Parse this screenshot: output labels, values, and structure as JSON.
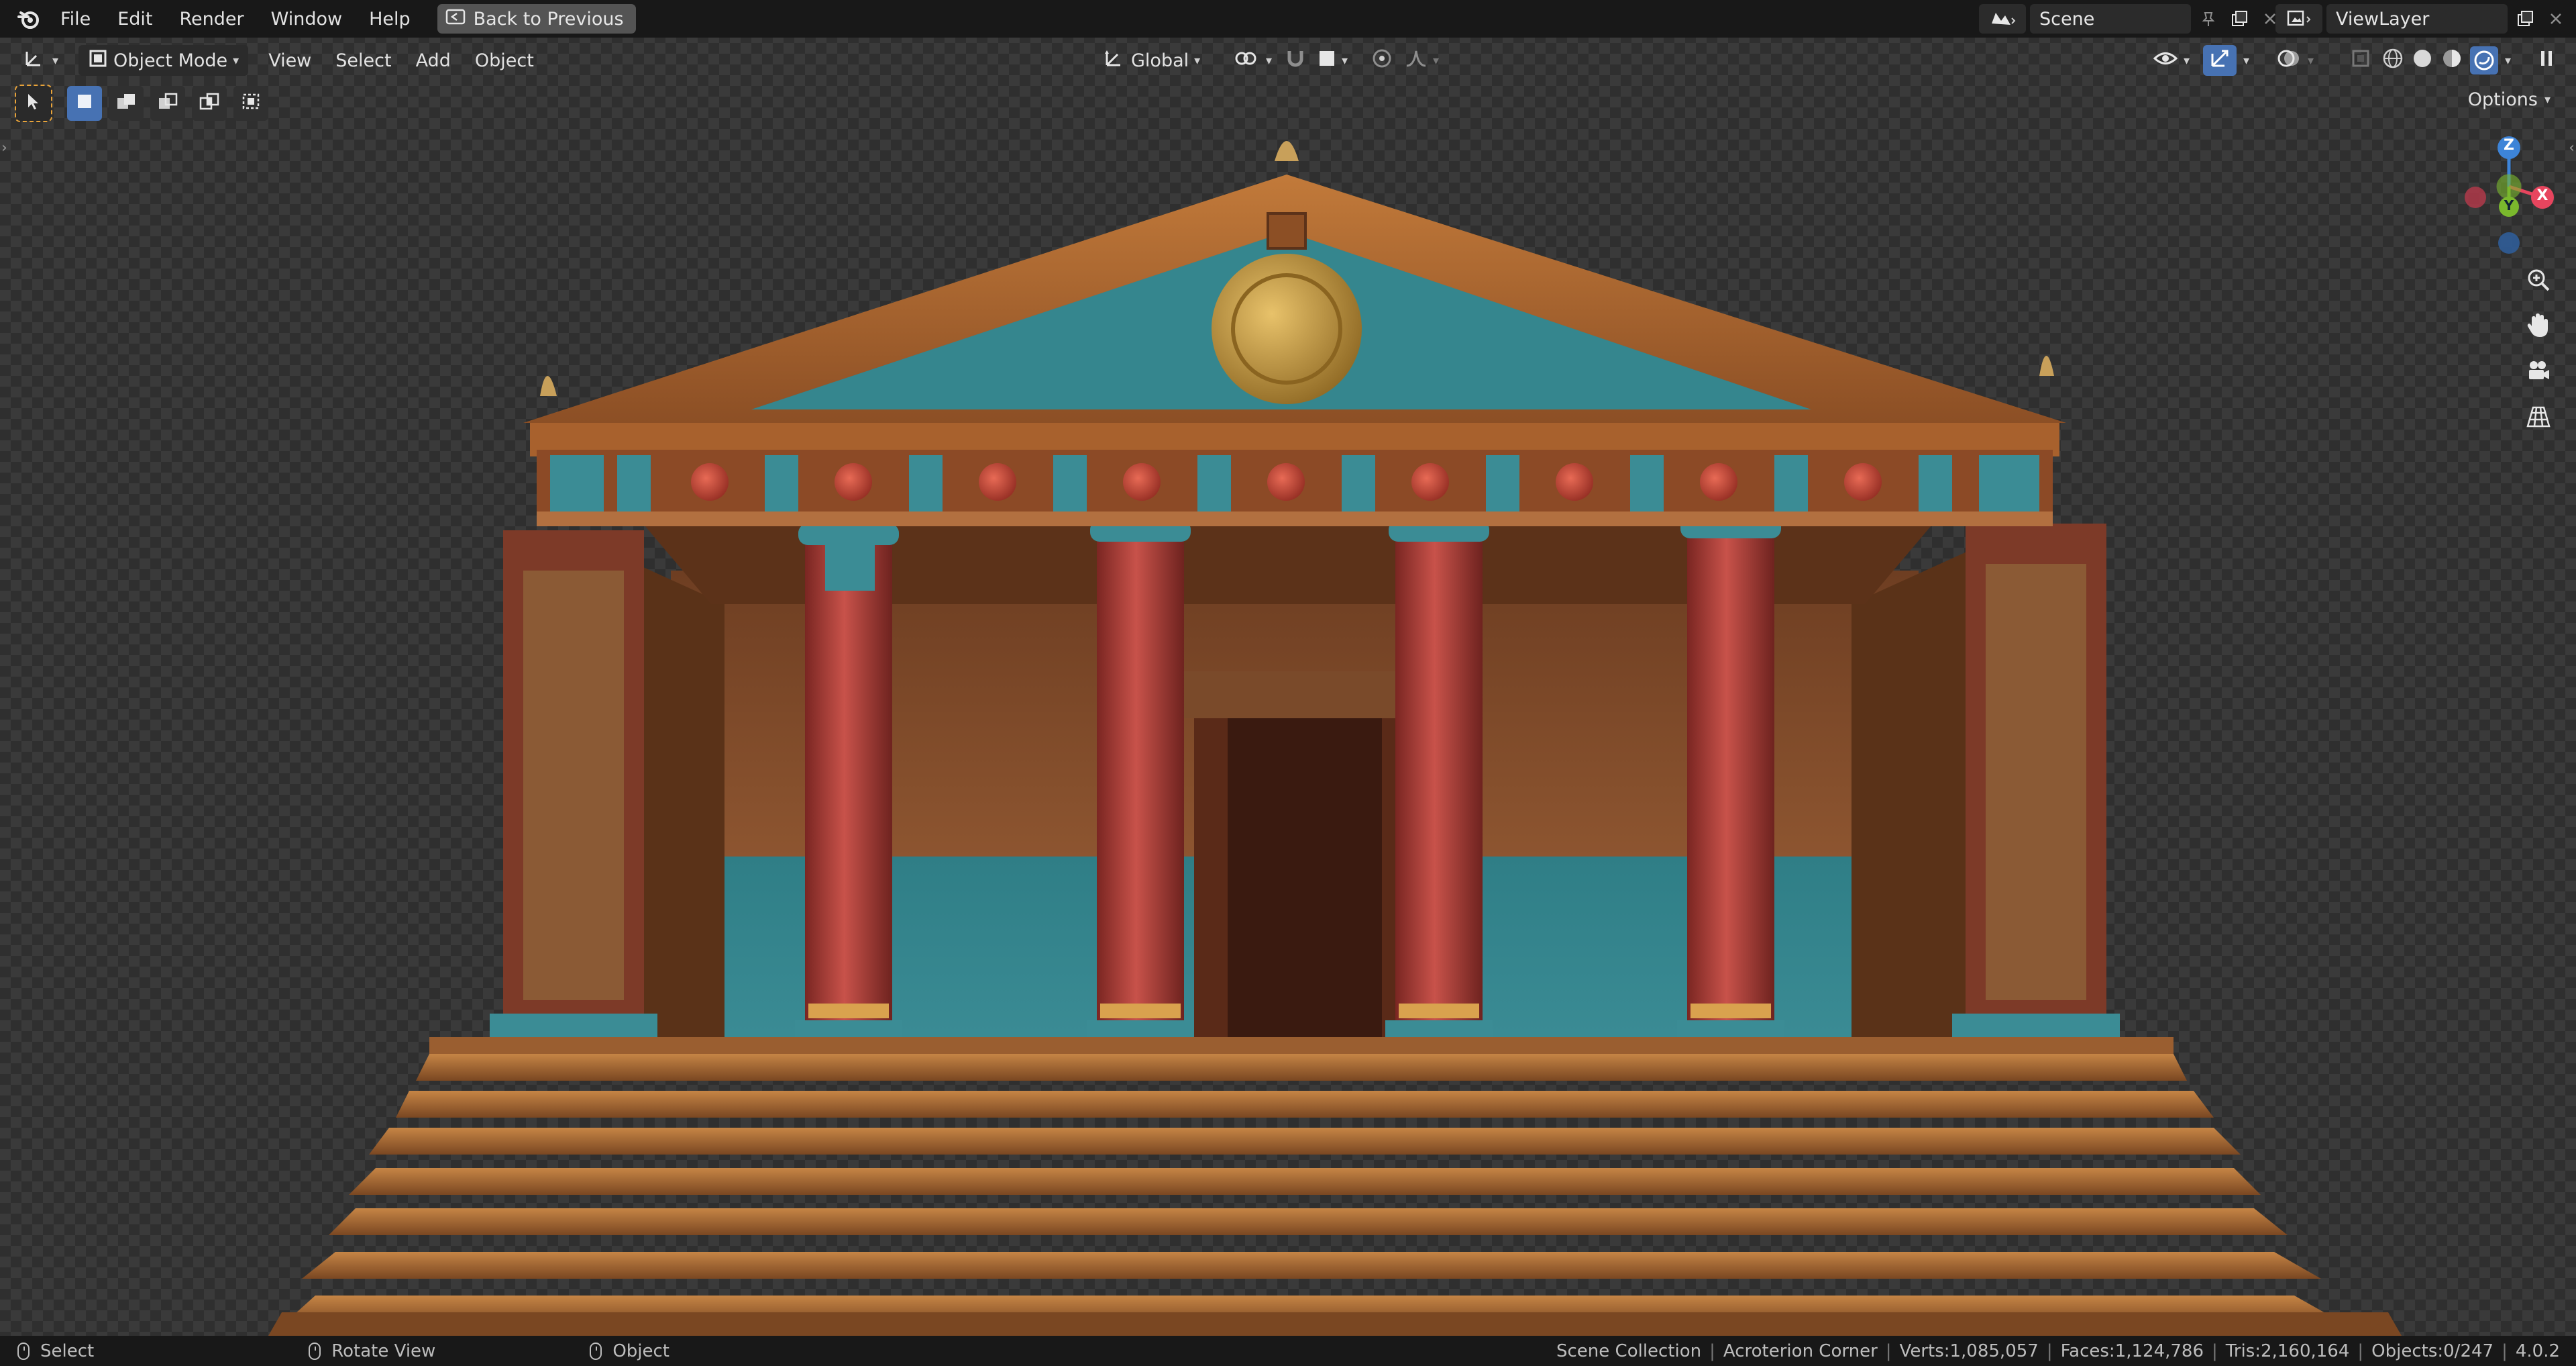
{
  "menubar": {
    "items": [
      "File",
      "Edit",
      "Render",
      "Window",
      "Help"
    ],
    "back_label": "Back to Previous",
    "scene_name": "Scene",
    "view_layer_name": "ViewLayer"
  },
  "header": {
    "mode_label": "Object Mode",
    "menus": [
      "View",
      "Select",
      "Add",
      "Object"
    ],
    "transform_orientation": "Global",
    "options_label": "Options"
  },
  "gizmo": {
    "axes": [
      "Z",
      "Y",
      "X"
    ],
    "colors": {
      "x": "#e7455e",
      "y": "#7ab82d",
      "z": "#3d84d8"
    }
  },
  "statusbar": {
    "hints": [
      {
        "action": "Select"
      },
      {
        "action": "Rotate View"
      },
      {
        "action": "Object"
      }
    ],
    "collection": "Scene Collection",
    "active_object": "Acroterion Corner",
    "verts": "Verts:1,085,057",
    "faces": "Faces:1,124,786",
    "tris": "Tris:2,160,164",
    "objects": "Objects:0/247",
    "version": "4.0.2"
  },
  "colors": {
    "accent": "#4772b3",
    "wood": "#b06a33",
    "column_red": "#b53f3a",
    "teal": "#3b8c95"
  }
}
